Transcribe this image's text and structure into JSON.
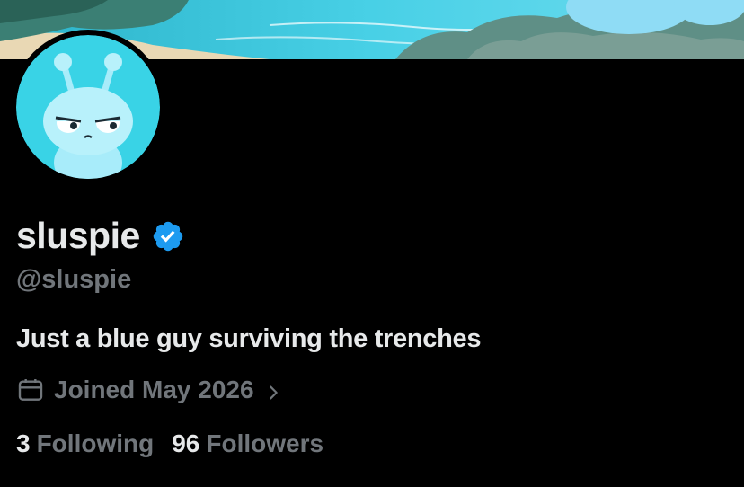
{
  "profile": {
    "display_name": "sluspie",
    "verified": true,
    "handle": "@sluspie",
    "bio": "Just a blue guy surviving the trenches",
    "joined": "Joined May 2026"
  },
  "stats": {
    "following_count": "3",
    "following_label": "Following",
    "followers_count": "96",
    "followers_label": "Followers"
  },
  "icons": {
    "verified": "verified-badge-icon",
    "calendar": "calendar-icon",
    "chevron": "chevron-right-icon"
  },
  "colors": {
    "background": "#000000",
    "primary_text": "#e7e9ea",
    "secondary_text": "#71767b",
    "verified_blue": "#1d9bf0"
  }
}
